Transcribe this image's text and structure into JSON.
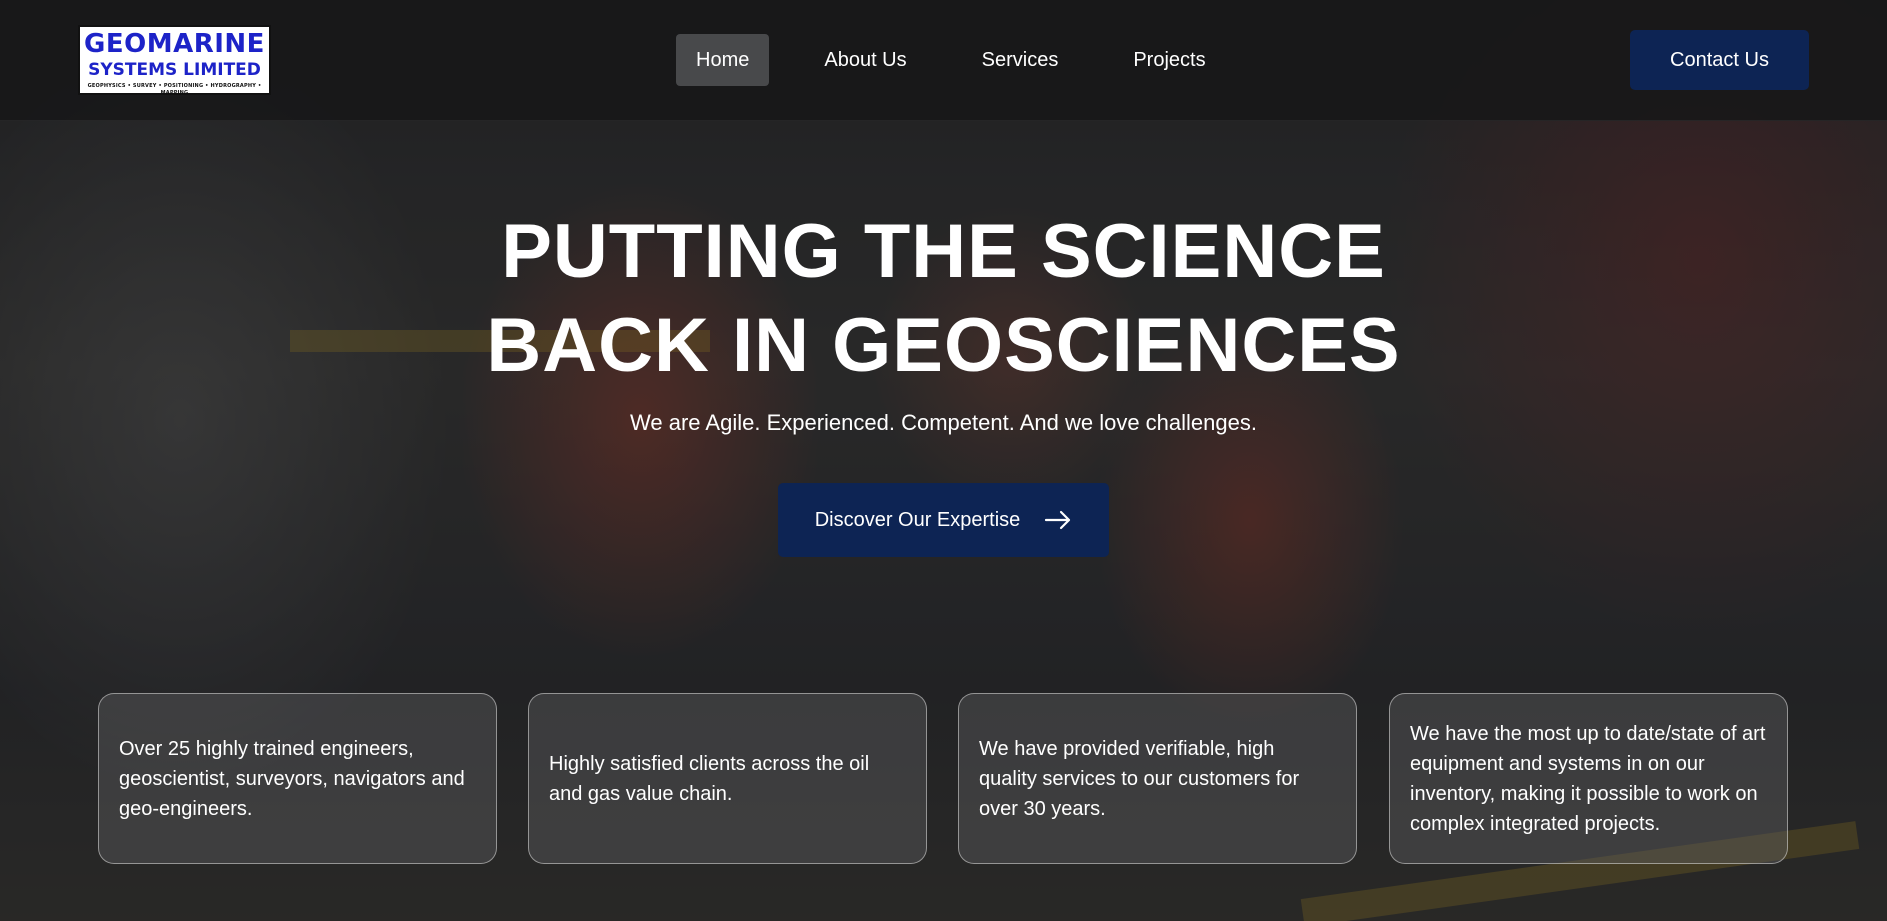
{
  "nav": {
    "logo": {
      "line1": "GEOMARINE",
      "line2": "SYSTEMS LIMITED",
      "line3": "GEOPHYSICS • SURVEY • POSITIONING • HYDROGRAPHY • MAPPING"
    },
    "links": [
      {
        "label": "Home",
        "active": true
      },
      {
        "label": "About Us",
        "active": false
      },
      {
        "label": "Services",
        "active": false
      },
      {
        "label": "Projects",
        "active": false
      }
    ],
    "contact_label": "Contact Us"
  },
  "hero": {
    "title_line1": "PUTTING THE SCIENCE",
    "title_line2": "BACK IN GEOSCIENCES",
    "subtitle": "We are Agile. Experienced. Competent. And we love challenges.",
    "cta_label": "Discover Our Expertise",
    "cta_icon": "arrow-right-icon"
  },
  "cards": [
    {
      "text": "Over 25 highly trained engineers, geoscientist, surveyors, navigators and geo-engineers."
    },
    {
      "text": "Highly satisfied clients across the oil and gas value chain."
    },
    {
      "text": "We have provided verifiable, high quality services to our customers for over 30 years."
    },
    {
      "text": "We have the most up to date/state of art equipment and systems in on our inventory, making it possible to work on complex integrated projects."
    }
  ],
  "colors": {
    "primary_navy": "#0d2454",
    "logo_blue": "#1d23c8",
    "nav_active": "#48494b"
  }
}
